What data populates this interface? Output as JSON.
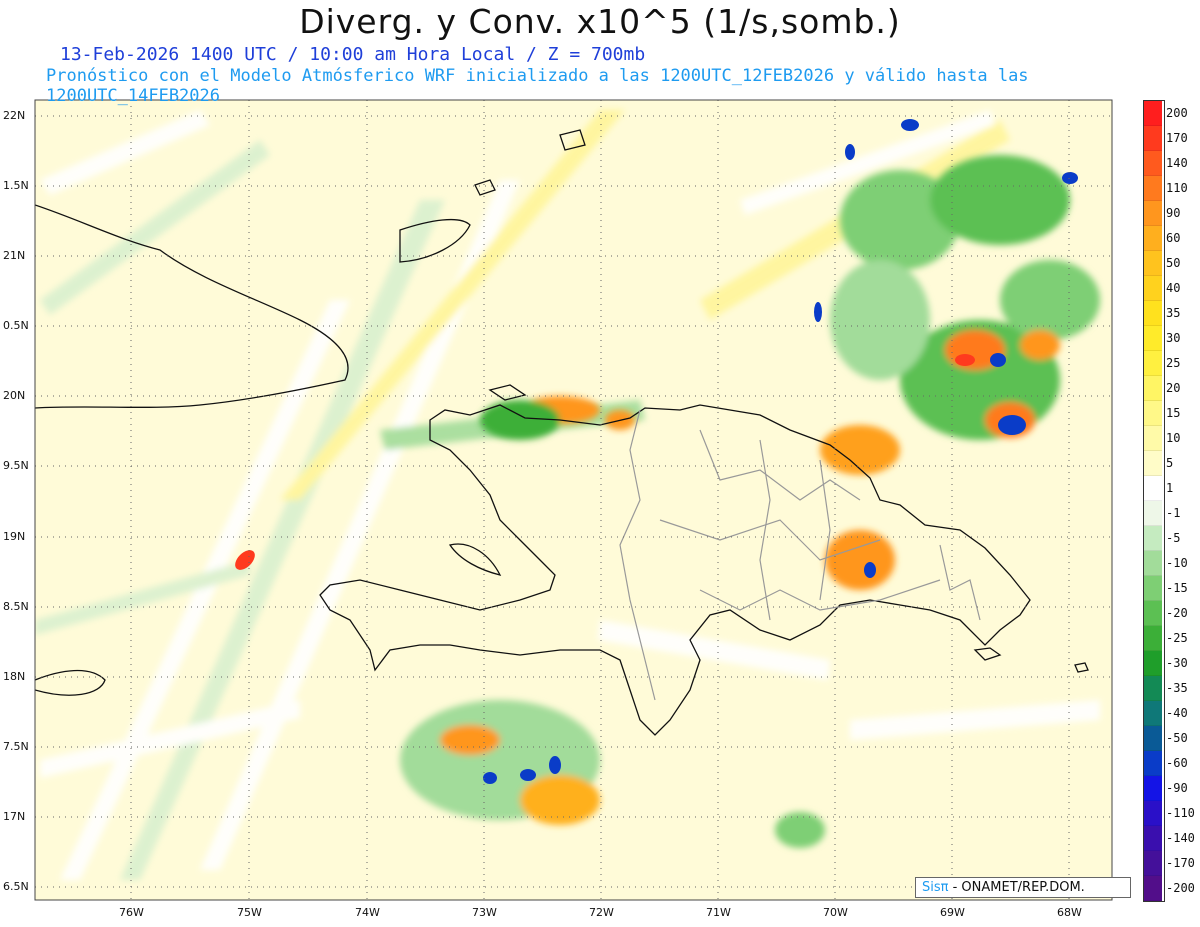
{
  "header": {
    "title": "Diverg. y Conv. x10^5 (1/s,somb.)",
    "line1": "13-Feb-2026  1400 UTC / 10:00 am Hora Local / Z = 700mb",
    "line2": "Pronóstico con el Modelo Atmósferico WRF inicializado a las 1200UTC_12FEB2026 y válido hasta las  1200UTC_14FEB2026"
  },
  "axes": {
    "lat_labels": [
      "22N",
      "1.5N",
      "21N",
      "0.5N",
      "20N",
      "9.5N",
      "19N",
      "8.5N",
      "18N",
      "7.5N",
      "17N",
      "6.5N"
    ],
    "lon_labels": [
      "76W",
      "75W",
      "74W",
      "73W",
      "72W",
      "71W",
      "70W",
      "69W",
      "68W"
    ]
  },
  "colorbar": {
    "labels": [
      "200",
      "170",
      "140",
      "110",
      "90",
      "60",
      "50",
      "40",
      "35",
      "30",
      "25",
      "20",
      "15",
      "10",
      "5",
      "1",
      "-1",
      "-5",
      "-10",
      "-15",
      "-20",
      "-25",
      "-30",
      "-35",
      "-40",
      "-50",
      "-60",
      "-90",
      "-110",
      "-140",
      "-170",
      "-200"
    ],
    "colors": [
      "#ff1e1e",
      "#ff3a1e",
      "#ff5a1e",
      "#ff7a1e",
      "#ff961e",
      "#ffaf1e",
      "#ffc31e",
      "#ffd21e",
      "#ffe11e",
      "#ffeb2a",
      "#fff040",
      "#fff564",
      "#fff888",
      "#fffaa8",
      "#fffcc8",
      "#ffffff",
      "#eef7e8",
      "#c5ebc0",
      "#a2dc9a",
      "#7ecf74",
      "#5cc053",
      "#3caf38",
      "#1f9e2a",
      "#138a55",
      "#0f7878",
      "#0a5a96",
      "#0a3cc8",
      "#1414e6",
      "#2a10c8",
      "#3a0fae",
      "#44109a",
      "#520e8a"
    ],
    "accent_colors": {
      "convergence_core": "#0a3cc8",
      "divergence_core": "#ff3a1e",
      "green_band": "#3caf38",
      "yellow_band": "#fff564"
    }
  },
  "credit": {
    "sis": "Sisπ",
    "text": "- ONAMET/REP.DOM."
  }
}
